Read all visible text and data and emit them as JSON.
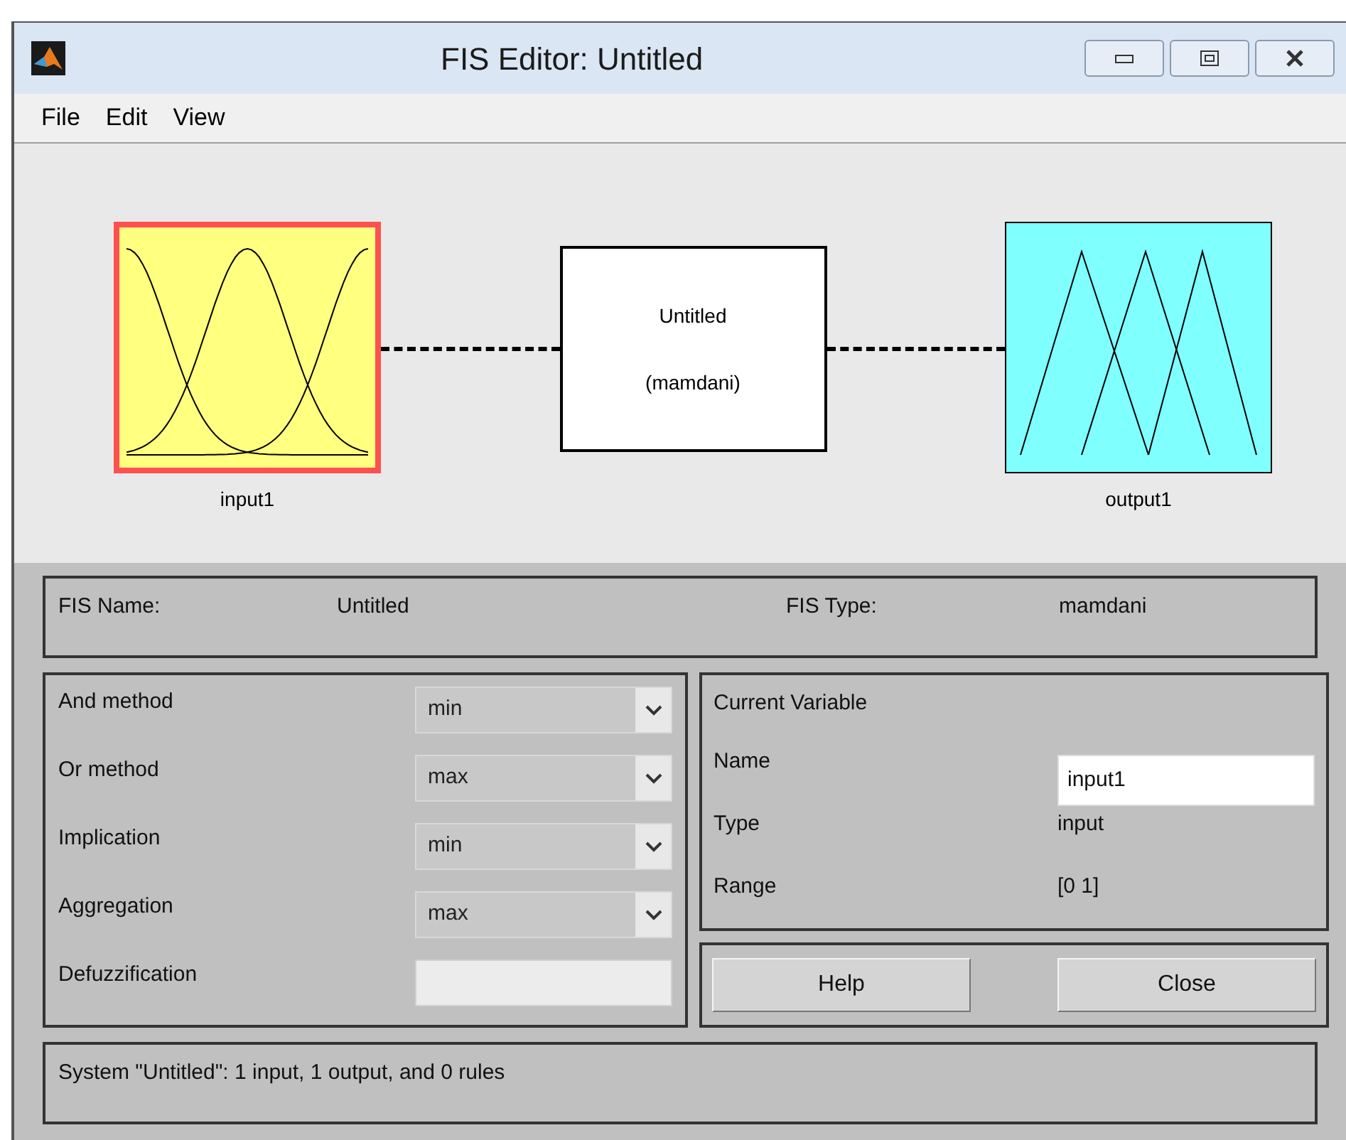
{
  "window": {
    "title": "FIS Editor: Untitled"
  },
  "menu": [
    "File",
    "Edit",
    "View"
  ],
  "diagram": {
    "inputs": [
      {
        "label": "input1",
        "selected": true
      }
    ],
    "system": {
      "name": "Untitled",
      "type": "(mamdani)"
    },
    "outputs": [
      {
        "label": "output1",
        "selected": false
      }
    ]
  },
  "fis": {
    "name_label": "FIS Name:",
    "name": "Untitled",
    "type_label": "FIS Type:",
    "type": "mamdani"
  },
  "methods": [
    {
      "label": "And method",
      "kind": "dropdown",
      "value": "min"
    },
    {
      "label": "Or method",
      "kind": "dropdown",
      "value": "max"
    },
    {
      "label": "Implication",
      "kind": "dropdown",
      "value": "min"
    },
    {
      "label": "Aggregation",
      "kind": "dropdown",
      "value": "max"
    },
    {
      "label": "Defuzzification",
      "kind": "blank"
    }
  ],
  "current_variable": {
    "title": "Current Variable",
    "name_label": "Name",
    "name": "input1",
    "type_label": "Type",
    "type": "input",
    "range_label": "Range",
    "range": "[0 1]"
  },
  "buttons": [
    "Help",
    "Close"
  ],
  "status": "System \"Untitled\": 1 input, 1 output, and 0 rules"
}
